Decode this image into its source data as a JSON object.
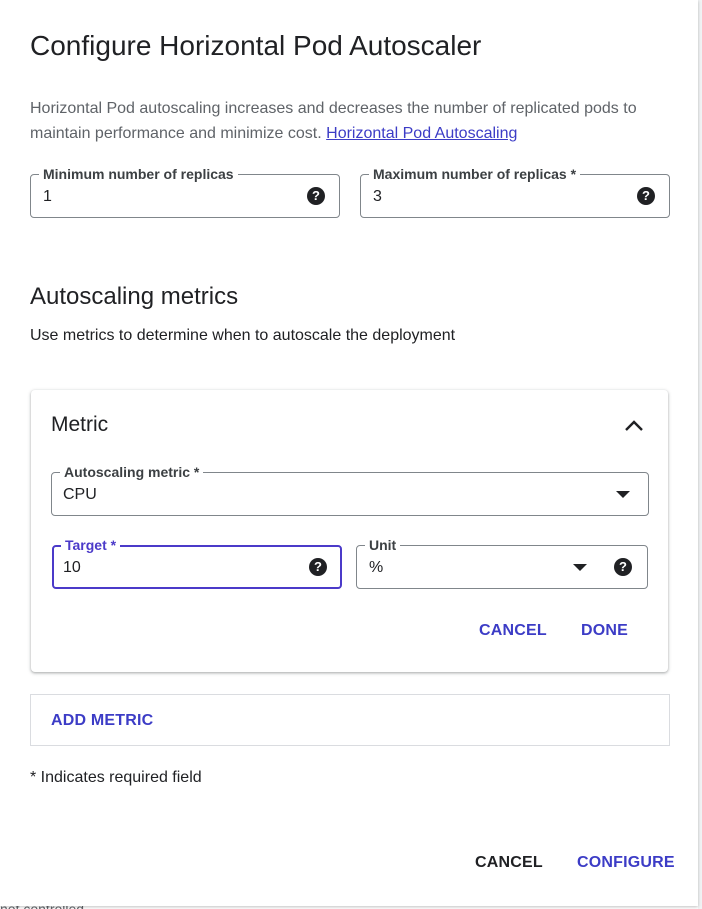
{
  "dialog": {
    "title": "Configure Horizontal Pod Autoscaler",
    "description": "Horizontal Pod autoscaling increases and decreases the number of replicated pods to maintain performance and minimize cost.",
    "description_link": "Horizontal Pod Autoscaling"
  },
  "replicas": {
    "min_label": "Minimum number of replicas",
    "min_value": "1",
    "max_label": "Maximum number of replicas *",
    "max_value": "3"
  },
  "autoscaling": {
    "title": "Autoscaling metrics",
    "description": "Use metrics to determine when to autoscale the deployment"
  },
  "metric_card": {
    "title": "Metric",
    "metric_label": "Autoscaling metric *",
    "metric_value": "CPU",
    "target_label": "Target *",
    "target_value": "10",
    "unit_label": "Unit",
    "unit_value": "%",
    "cancel_label": "CANCEL",
    "done_label": "DONE"
  },
  "add_metric_label": "ADD METRIC",
  "required_note": "* Indicates required field",
  "footer": {
    "cancel_label": "CANCEL",
    "configure_label": "CONFIGURE"
  },
  "background": {
    "partial_text": "not controlled"
  },
  "icons": {
    "help": "help-icon",
    "dropdown": "chevron-down-icon",
    "collapse": "chevron-up-icon"
  },
  "colors": {
    "accent": "#3c3cc6",
    "focus_border": "#4b3ac9",
    "field_border": "#80868b",
    "text_secondary": "#5f6368"
  }
}
